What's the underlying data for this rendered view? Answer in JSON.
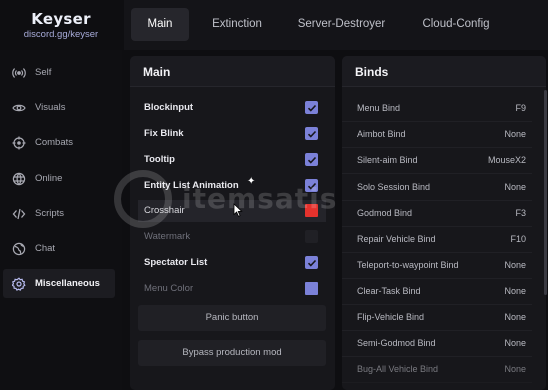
{
  "brand": {
    "title": "Keyser",
    "subtitle": "discord.gg/keyser"
  },
  "tabs": [
    {
      "label": "Main",
      "active": true
    },
    {
      "label": "Extinction",
      "active": false
    },
    {
      "label": "Server-Destroyer",
      "active": false
    },
    {
      "label": "Cloud-Config",
      "active": false
    }
  ],
  "sidebar": {
    "items": [
      {
        "label": "Self",
        "icon": "broadcast-icon"
      },
      {
        "label": "Visuals",
        "icon": "eye-icon"
      },
      {
        "label": "Combats",
        "icon": "crosshair-icon"
      },
      {
        "label": "Online",
        "icon": "globe-icon"
      },
      {
        "label": "Scripts",
        "icon": "code-icon"
      },
      {
        "label": "Chat",
        "icon": "globe-chat-icon"
      },
      {
        "label": "Miscellaneous",
        "icon": "gear-icon",
        "active": true
      }
    ]
  },
  "main_panel": {
    "title": "Main",
    "options": [
      {
        "label": "Blockinput",
        "checked": true
      },
      {
        "label": "Fix Blink",
        "checked": true
      },
      {
        "label": "Tooltip",
        "checked": true
      },
      {
        "label": "Entity List Animation",
        "checked": true
      },
      {
        "label": "Crosshair",
        "color": "#e5322d"
      },
      {
        "label": "Watermark",
        "checked": false
      },
      {
        "label": "Spectator List",
        "checked": true
      },
      {
        "label": "Menu Color",
        "color": "#7b81d8"
      }
    ],
    "buttons": [
      "Panic button",
      "Bypass production mod"
    ]
  },
  "binds_panel": {
    "title": "Binds",
    "rows": [
      {
        "name": "Menu Bind",
        "key": "F9"
      },
      {
        "name": "Aimbot Bind",
        "key": "None"
      },
      {
        "name": "Silent-aim Bind",
        "key": "MouseX2"
      },
      {
        "name": "Solo Session Bind",
        "key": "None"
      },
      {
        "name": "Godmod Bind",
        "key": "F3"
      },
      {
        "name": "Repair Vehicle Bind",
        "key": "F10"
      },
      {
        "name": "Teleport-to-waypoint Bind",
        "key": "None"
      },
      {
        "name": "Clear-Task Bind",
        "key": "None"
      },
      {
        "name": "Flip-Vehicle Bind",
        "key": "None"
      },
      {
        "name": "Semi-Godmod Bind",
        "key": "None"
      },
      {
        "name": "Bug-All Vehicle Bind",
        "key": "None"
      }
    ]
  },
  "watermark": {
    "text": "itemsatis"
  },
  "colors": {
    "accent": "#7b81d8",
    "crosshair": "#e5322d",
    "background": "#0e0e11",
    "panel": "#17171b"
  }
}
